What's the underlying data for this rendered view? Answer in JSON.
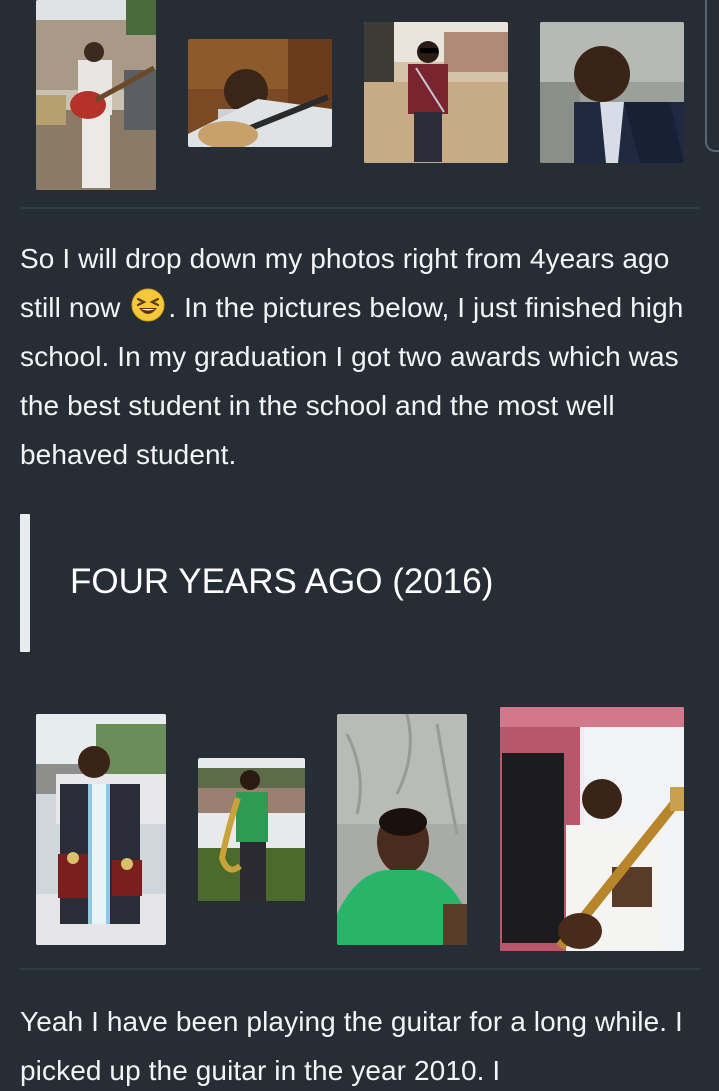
{
  "post": {
    "paragraph_1_part_1": "So I will drop down my photos right from 4years ago still now",
    "paragraph_1_emoji": "laughing-squinting-face-emoji",
    "paragraph_1_part_2": ". In the pictures below, I just finished high school. In my graduation I got two awards which was the best student in the school and the most well behaved student.",
    "section_heading": "FOUR YEARS AGO (2016)",
    "paragraph_2": "Yeah I have been playing the guitar for a long while. I picked up the guitar in the year 2010. I"
  },
  "colors": {
    "background": "#262d35",
    "text": "#f2f4f6",
    "divider": "#323a44",
    "quote_bar": "#e9ecef"
  },
  "photo_rows": {
    "row_1": [
      "guitar-outdoor-photo",
      "guitar-selfie-photo",
      "sunglasses-street-photo",
      "selfie-vest-photo"
    ],
    "row_2": [
      "graduation-awards-photo",
      "saxophone-photo",
      "green-shirt-selfie-photo",
      "guitar-indoor-photo"
    ]
  }
}
